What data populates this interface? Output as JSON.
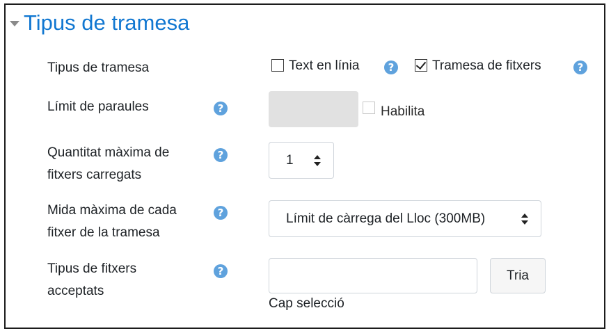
{
  "section": {
    "title": "Tipus de tramesa"
  },
  "rows": {
    "submission_types": {
      "label": "Tipus de tramesa",
      "online_text": {
        "label": "Text en línia",
        "checked": false
      },
      "file_submissions": {
        "label": "Tramesa de fitxers",
        "checked": true
      }
    },
    "word_limit": {
      "label": "Límit de paraules",
      "enable": {
        "label": "Habilita",
        "checked": false
      }
    },
    "max_files": {
      "label_line1": "Quantitat màxima de",
      "label_line2": "fitxers carregats",
      "value": "1"
    },
    "max_size": {
      "label_line1": "Mida màxima de cada",
      "label_line2": "fitxer de la tramesa",
      "value": "Límit de càrrega del Lloc (300MB)"
    },
    "file_types": {
      "label_line1": "Tipus de fitxers",
      "label_line2": "acceptats",
      "choose_button": "Tria",
      "selection_note": "Cap selecció"
    }
  },
  "help_glyph": "?",
  "colors": {
    "title": "#1177d1",
    "help_icon": "#5fa2dd",
    "disabled_field": "#e1e1e1"
  }
}
